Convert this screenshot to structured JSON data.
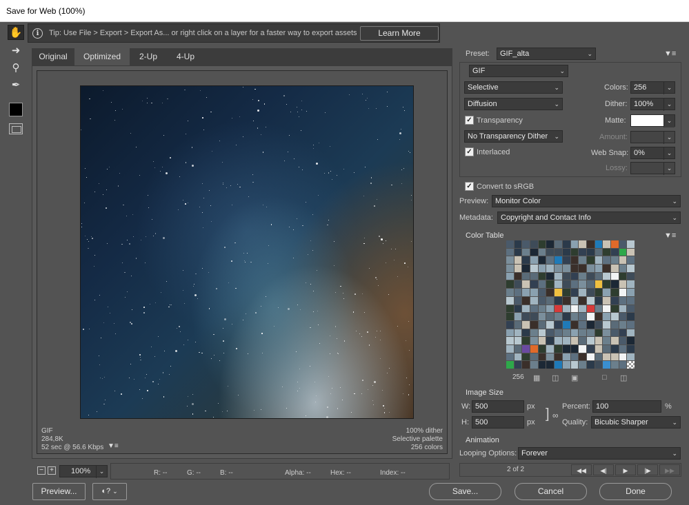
{
  "window": {
    "title": "Save for Web (100%)"
  },
  "tip": {
    "text": "Tip: Use File > Export > Export As...  or right click on a layer for a faster way to export assets",
    "button": "Learn More"
  },
  "toolbar": {
    "icons": [
      "hand-icon",
      "slice-select-icon",
      "zoom-icon",
      "eyedropper-icon",
      "eyedropper-color-swatch",
      "toggle-slices-icon"
    ]
  },
  "tabs": [
    "Original",
    "Optimized",
    "2-Up",
    "4-Up"
  ],
  "preview": {
    "format": "GIF",
    "size": "284,8K",
    "time": "52 sec @ 56.6 Kbps",
    "dither": "100% dither",
    "palette": "Selective palette",
    "colors": "256 colors"
  },
  "zoom": {
    "minus": "−",
    "plus": "+",
    "value": "100%"
  },
  "readouts": {
    "r": "R: --",
    "g": "G: --",
    "b": "B: --",
    "alpha": "Alpha: --",
    "hex": "Hex: --",
    "index": "Index: --"
  },
  "buttons": {
    "preview": "Preview...",
    "save": "Save...",
    "cancel": "Cancel",
    "done": "Done"
  },
  "settings": {
    "preset_label": "Preset:",
    "preset_value": "GIF_alta",
    "format": "GIF",
    "reduction": "Selective",
    "dither_algo": "Diffusion",
    "transparency": "Transparency",
    "transparency_dither": "No Transparency Dither",
    "interlaced": "Interlaced",
    "colors_label": "Colors:",
    "colors_value": "256",
    "dither_label": "Dither:",
    "dither_value": "100%",
    "matte_label": "Matte:",
    "amount_label": "Amount:",
    "websnap_label": "Web Snap:",
    "websnap_value": "0%",
    "lossy_label": "Lossy:",
    "convert_srgb": "Convert to sRGB",
    "preview_label": "Preview:",
    "preview_value": "Monitor Color",
    "metadata_label": "Metadata:",
    "metadata_value": "Copyright and Contact Info"
  },
  "color_table": {
    "title": "Color Table",
    "count": "256",
    "palette": [
      "#3a2f2a",
      "#5a6b78",
      "#8aa1b0",
      "#2b3a4a",
      "#b8c8d0",
      "#6b7f8c",
      "#2e3d2f",
      "#c9c2b4",
      "#4a5a6a",
      "#f2f4f5",
      "#324052",
      "#a0b4c0",
      "#1c2835",
      "#7b8f9c",
      "#3e4b58",
      "#5d7080"
    ]
  },
  "image_size": {
    "title": "Image Size",
    "w_label": "W:",
    "w_value": "500",
    "w_unit": "px",
    "h_label": "H:",
    "h_value": "500",
    "h_unit": "px",
    "percent_label": "Percent:",
    "percent_value": "100",
    "percent_unit": "%",
    "quality_label": "Quality:",
    "quality_value": "Bicubic Sharper"
  },
  "animation": {
    "title": "Animation",
    "looping_label": "Looping Options:",
    "looping_value": "Forever",
    "frame": "2 of 2",
    "controls": [
      "first-frame-icon",
      "previous-frame-icon",
      "play-icon",
      "next-frame-icon",
      "last-frame-icon"
    ]
  }
}
